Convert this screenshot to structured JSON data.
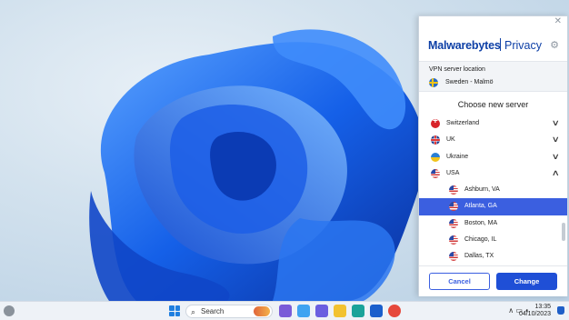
{
  "panel": {
    "close_glyph": "✕",
    "brand_name": "Malwarebytes",
    "brand_product": "Privacy",
    "settings_icon": "gear-icon",
    "location_label": "VPN server location",
    "location_value": "Sweden - Malmö",
    "choose_title": "Choose new server",
    "countries": [
      {
        "label": "Switzerland",
        "chevron": "∨"
      },
      {
        "label": "UK",
        "chevron": "∨"
      },
      {
        "label": "Ukraine",
        "chevron": "∨"
      },
      {
        "label": "USA",
        "chevron": "∧"
      }
    ],
    "cities": [
      {
        "label": "Ashburn, VA"
      },
      {
        "label": "Atlanta, GA",
        "selected": true
      },
      {
        "label": "Boston, MA"
      },
      {
        "label": "Chicago, IL"
      },
      {
        "label": "Dallas, TX"
      }
    ],
    "cancel_label": "Cancel",
    "change_label": "Change",
    "accent_color": "#3b5fe0",
    "brand_color": "#0d3fa6"
  },
  "taskbar": {
    "search_label": "Search",
    "search_icon": "⌕",
    "time": "13:35",
    "date": "04/10/2023",
    "tray_glyphs": "∧  ▭ ◖"
  }
}
